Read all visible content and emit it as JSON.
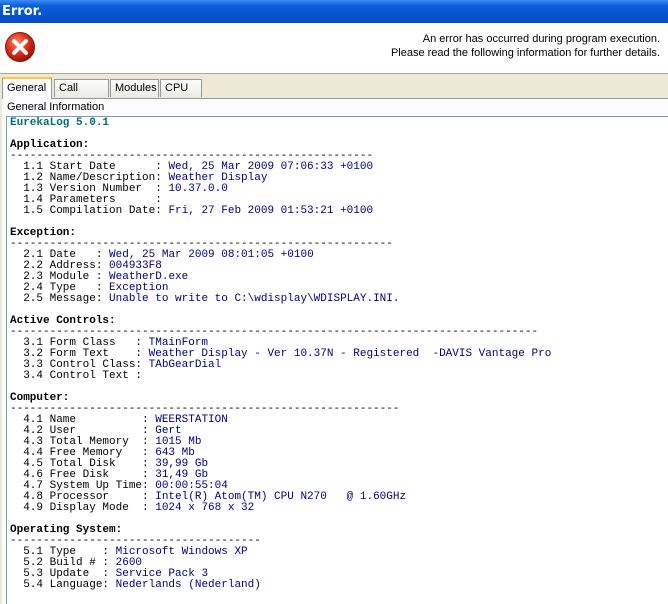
{
  "window": {
    "title": "Error."
  },
  "message": {
    "line1": "An error has occurred during program execution.",
    "line2": "Please read the following information for further details."
  },
  "tabs": [
    {
      "label": "General",
      "active": true
    },
    {
      "label": "Call Stack",
      "active": false
    },
    {
      "label": "Modules",
      "active": false
    },
    {
      "label": "CPU",
      "active": false
    }
  ],
  "panel": {
    "label": "General Information"
  },
  "report": {
    "product": "EurekaLog 5.0.1",
    "sections": [
      {
        "title": "Application:",
        "rule": "-------------------------------------------------------",
        "items": [
          {
            "key": "  1.1 Start Date      : ",
            "value": "Wed, 25 Mar 2009 07:06:33 +0100"
          },
          {
            "key": "  1.2 Name/Description: ",
            "value": "Weather Display"
          },
          {
            "key": "  1.3 Version Number  : ",
            "value": "10.37.0.0"
          },
          {
            "key": "  1.4 Parameters      : ",
            "value": ""
          },
          {
            "key": "  1.5 Compilation Date: ",
            "value": "Fri, 27 Feb 2009 01:53:21 +0100"
          }
        ]
      },
      {
        "title": "Exception:",
        "rule": "----------------------------------------------------------",
        "items": [
          {
            "key": "  2.1 Date   : ",
            "value": "Wed, 25 Mar 2009 08:01:05 +0100"
          },
          {
            "key": "  2.2 Address: ",
            "value": "004933F8"
          },
          {
            "key": "  2.3 Module : ",
            "value": "WeatherD.exe"
          },
          {
            "key": "  2.4 Type   : ",
            "value": "Exception"
          },
          {
            "key": "  2.5 Message: ",
            "value": "Unable to write to C:\\wdisplay\\WDISPLAY.INI."
          }
        ]
      },
      {
        "title": "Active Controls:",
        "rule": "--------------------------------------------------------------------------------",
        "items": [
          {
            "key": "  3.1 Form Class   : ",
            "value": "TMainForm"
          },
          {
            "key": "  3.2 Form Text    : ",
            "value": "Weather Display - Ver 10.37N - Registered  -DAVIS Vantage Pro"
          },
          {
            "key": "  3.3 Control Class: ",
            "value": "TAbGearDial"
          },
          {
            "key": "  3.4 Control Text : ",
            "value": ""
          }
        ]
      },
      {
        "title": "Computer:",
        "rule": "-----------------------------------------------------------",
        "items": [
          {
            "key": "  4.1 Name          : ",
            "value": "WEERSTATION"
          },
          {
            "key": "  4.2 User          : ",
            "value": "Gert"
          },
          {
            "key": "  4.3 Total Memory  : ",
            "value": "1015 Mb"
          },
          {
            "key": "  4.4 Free Memory   : ",
            "value": "643 Mb"
          },
          {
            "key": "  4.5 Total Disk    : ",
            "value": "39,99 Gb"
          },
          {
            "key": "  4.6 Free Disk     : ",
            "value": "31,49 Gb"
          },
          {
            "key": "  4.7 System Up Time: ",
            "value": "00:00:55:04"
          },
          {
            "key": "  4.8 Processor     : ",
            "value": "Intel(R) Atom(TM) CPU N270   @ 1.60GHz"
          },
          {
            "key": "  4.9 Display Mode  : ",
            "value": "1024 x 768 x 32"
          }
        ]
      },
      {
        "title": "Operating System:",
        "rule": "--------------------------------------",
        "items": [
          {
            "key": "  5.1 Type    : ",
            "value": "Microsoft Windows XP"
          },
          {
            "key": "  5.2 Build # : ",
            "value": "2600"
          },
          {
            "key": "  5.3 Update  : ",
            "value": "Service Pack 3"
          },
          {
            "key": "  5.4 Language: ",
            "value": "Nederlands (Nederland)"
          }
        ]
      }
    ]
  },
  "colors": {
    "title_bar": "#0653cf",
    "value_text": "#000080",
    "product_text": "#007070",
    "error_icon": "#e03020"
  },
  "icons": {
    "error": "error-icon"
  }
}
